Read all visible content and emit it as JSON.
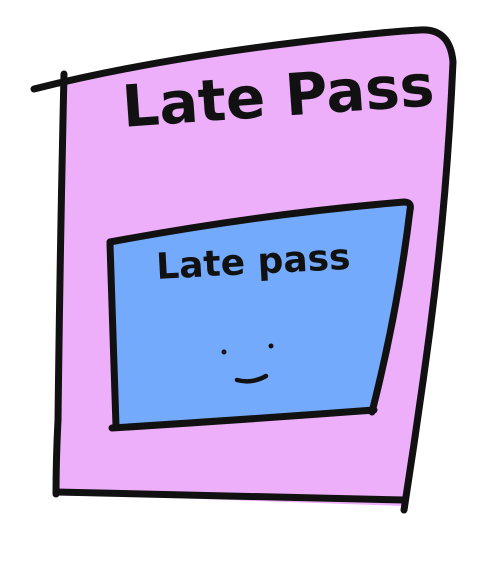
{
  "card": {
    "title": "Late Pass",
    "fill_color": "#EDAEFA",
    "stroke_color": "#111111"
  },
  "inner_panel": {
    "title": "Late pass",
    "fill_color": "#74AAFB",
    "stroke_color": "#111111"
  },
  "face": {
    "expression": "smile"
  }
}
